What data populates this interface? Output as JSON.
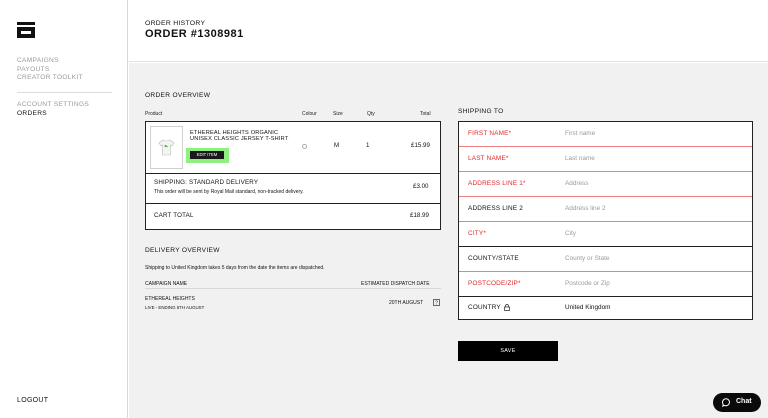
{
  "sidebar": {
    "group1": [
      "CAMPAIGNS",
      "PAYOUTS",
      "CREATOR TOOLKIT"
    ],
    "group2": [
      "ACCOUNT SETTINGS",
      "ORDERS"
    ],
    "logout": "LOGOUT"
  },
  "header": {
    "sub": "ORDER HISTORY",
    "title": "ORDER #1308981"
  },
  "order_overview": {
    "title": "ORDER OVERVIEW",
    "columns": [
      "Product",
      "Colour",
      "Size",
      "Qty",
      "Total"
    ],
    "item": {
      "name": "ETHEREAL HEIGHTS ORGANIC UNISEX CLASSIC JERSEY T-SHIRT",
      "edit": "EDIT ITEM",
      "size": "M",
      "qty": "1",
      "total": "£15.99"
    },
    "shipping_label": "SHIPPING: STANDARD DELIVERY",
    "shipping_note": "This order will be sent by Royal Mail standard, non-tracked delivery.",
    "shipping_price": "£3.00",
    "cart_label": "CART TOTAL",
    "cart_total": "£18.99"
  },
  "delivery": {
    "title": "DELIVERY OVERVIEW",
    "note": "Shipping to United Kingdom takes 5 days from the date the items are dispatched.",
    "col1": "CAMPAIGN NAME",
    "col2": "ESTIMATED DISPATCH DATE",
    "campaign": "ETHEREAL HEIGHTS",
    "campaign_status": "LIVE - ENDING 6TH AUGUST",
    "dispatch": "20TH AUGUST"
  },
  "shipping": {
    "title": "SHIPPING TO",
    "fields": [
      {
        "label": "FIRST NAME*",
        "placeholder": "First name",
        "required": true
      },
      {
        "label": "LAST NAME*",
        "placeholder": "Last name",
        "required": true
      },
      {
        "label": "ADDRESS LINE 1*",
        "placeholder": "Address",
        "required": true
      },
      {
        "label": "ADDRESS LINE 2",
        "placeholder": "Address line 2",
        "required": false
      },
      {
        "label": "CITY*",
        "placeholder": "City",
        "required": true
      },
      {
        "label": "COUNTY/STATE",
        "placeholder": "County or State",
        "required": false
      },
      {
        "label": "POSTCODE/ZIP*",
        "placeholder": "Postcode or Zip",
        "required": true
      },
      {
        "label": "COUNTRY",
        "value": "United Kingdom",
        "required": false
      }
    ],
    "save": "SAVE"
  },
  "chat": {
    "label": "Chat"
  },
  "colors": {
    "required": "#e0262b",
    "highlight": "#8ff07f",
    "accent": "#000000"
  },
  "icons": [
    "brand-logo-icon",
    "tshirt-icon",
    "help-icon",
    "lock-icon",
    "chat-bubble-icon"
  ]
}
